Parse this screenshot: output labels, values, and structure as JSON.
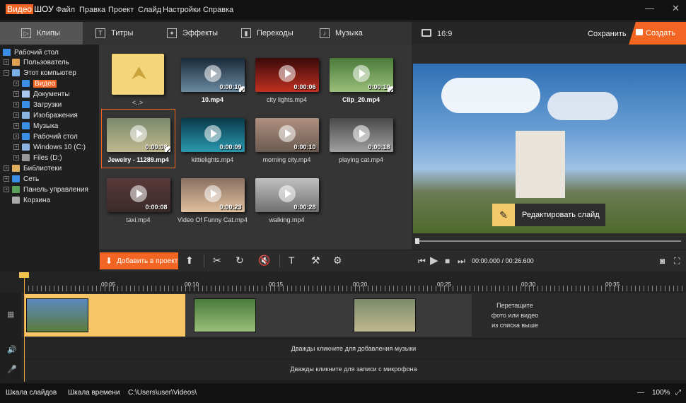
{
  "app": {
    "logo_part1": "Видео",
    "logo_part2": "ШОУ"
  },
  "menu": [
    "Файл",
    "Правка",
    "Проект",
    "Слайд",
    "Настройки",
    "Справка"
  ],
  "window_controls": {
    "minimize": "—",
    "close": "✕"
  },
  "tabs": [
    {
      "label": "Клипы",
      "icon": "play-icon",
      "active": true
    },
    {
      "label": "Титры",
      "icon": "titles-icon",
      "active": false
    },
    {
      "label": "Эффекты",
      "icon": "effects-icon",
      "active": false
    },
    {
      "label": "Переходы",
      "icon": "transitions-icon",
      "active": false
    },
    {
      "label": "Музыка",
      "icon": "music-icon",
      "active": false
    }
  ],
  "preview_header": {
    "ratio": "16:9",
    "save": "Сохранить",
    "create": "Создать"
  },
  "tree": [
    {
      "label": "Рабочий стол",
      "color": "#3a8ee6"
    },
    {
      "label": "Пользователь",
      "color": "#e0a050"
    },
    {
      "label": "Этот компьютер",
      "color": "#7ab0e8"
    },
    {
      "label": "Видео",
      "color": "#3a8ee6",
      "selected": true
    },
    {
      "label": "Документы",
      "color": "#aac8f0"
    },
    {
      "label": "Загрузки",
      "color": "#3a8ee6"
    },
    {
      "label": "Изображения",
      "color": "#8ab4e0"
    },
    {
      "label": "Музыка",
      "color": "#3a8ee6"
    },
    {
      "label": "Рабочий стол",
      "color": "#3a8ee6"
    },
    {
      "label": "Windows 10 (C:)",
      "color": "#8ab4e0"
    },
    {
      "label": "Files (D:)",
      "color": "#999"
    },
    {
      "label": "Библиотеки",
      "color": "#e0b060"
    },
    {
      "label": "Сеть",
      "color": "#3a8ee6"
    },
    {
      "label": "Панель управления",
      "color": "#5aa05a"
    },
    {
      "label": "Корзина",
      "color": "#aaa"
    }
  ],
  "files": [
    {
      "name": "<..>",
      "duration": "",
      "up": true
    },
    {
      "name": "10.mp4",
      "duration": "0:00:10",
      "checked": true,
      "bold": true,
      "colors": [
        "#1a2a3a",
        "#6a8aa0"
      ]
    },
    {
      "name": "city lights.mp4",
      "duration": "0:00:06",
      "colors": [
        "#3a0a0a",
        "#c03020"
      ]
    },
    {
      "name": "Clip_20.mp4",
      "duration": "0:00:10",
      "checked": true,
      "bold": true,
      "colors": [
        "#4a7a3a",
        "#9abf7a"
      ]
    },
    {
      "name": "Jewelry - 11289.mp4",
      "duration": "0:00:08",
      "checked": true,
      "bold": true,
      "colors": [
        "#7a8a6a",
        "#c0b890"
      ]
    },
    {
      "name": "kittielights.mp4",
      "duration": "0:00:09",
      "colors": [
        "#0a3a4a",
        "#2a9ab0"
      ]
    },
    {
      "name": "morning city.mp4",
      "duration": "0:00:10",
      "colors": [
        "#b09080",
        "#6a5a50"
      ]
    },
    {
      "name": "playing cat.mp4",
      "duration": "0:00:18",
      "colors": [
        "#4a4a4a",
        "#a0a0a0"
      ]
    },
    {
      "name": "taxi.mp4",
      "duration": "0:00:08",
      "colors": [
        "#5a3a3a",
        "#3a2a2a"
      ]
    },
    {
      "name": "Video Of Funny Cat.mp4",
      "duration": "0:00:23",
      "colors": [
        "#8a7060",
        "#e0c0a0"
      ]
    },
    {
      "name": "walking.mp4",
      "duration": "0:00:28",
      "colors": [
        "#c0c0c0",
        "#707070"
      ]
    }
  ],
  "preview": {
    "edit_slide": "Редактировать слайд",
    "time_current": "00:00.000",
    "time_total": "00:26.600"
  },
  "toolbar": {
    "add": "Добавить в проект"
  },
  "ruler": [
    "00:05",
    "00:10",
    "00:15",
    "00:20",
    "00:25",
    "00:30",
    "00:35"
  ],
  "timeline": {
    "drop_hint": [
      "Перетащите",
      "фото или видео",
      "из списка выше"
    ],
    "music_hint": "Дважды кликните для добавления музыки",
    "mic_hint": "Дважды кликните для записи с микрофона"
  },
  "status": {
    "tab1": "Шкала слайдов",
    "tab2": "Шкала времени",
    "path": "C:\\Users\\user\\Videos\\",
    "zoom_out": "—",
    "zoom": "100%",
    "fit": "⤢"
  }
}
